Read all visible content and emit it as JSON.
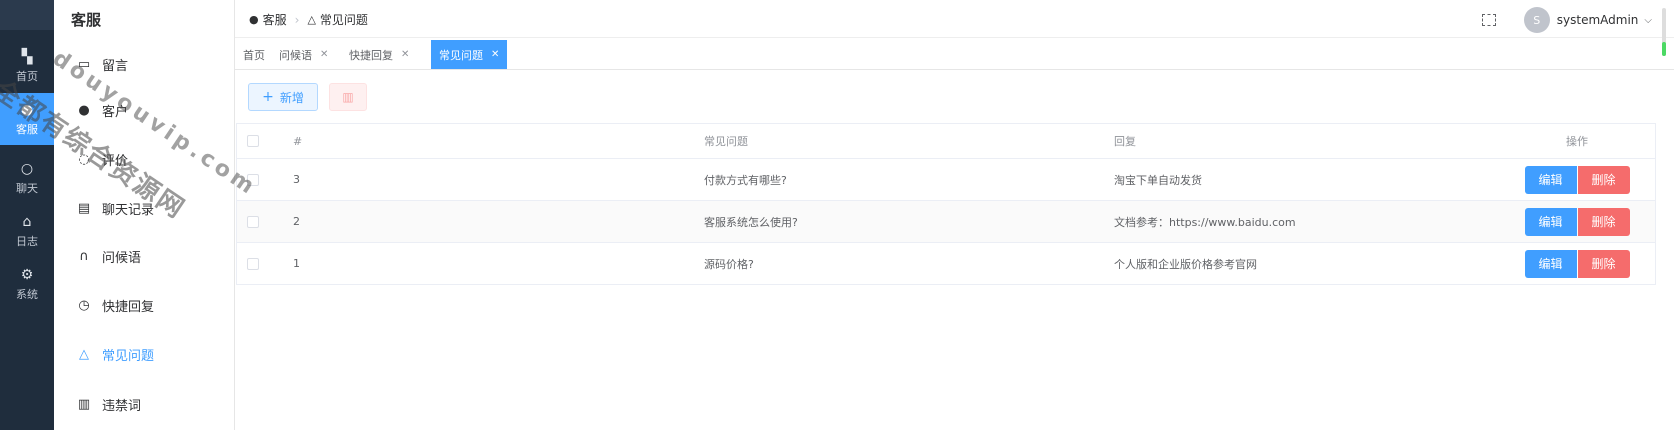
{
  "nav": {
    "items": [
      {
        "label": "首页",
        "icon": "dashboard-icon"
      },
      {
        "label": "客服",
        "icon": "user-icon",
        "active": true
      },
      {
        "label": "聊天",
        "icon": "person-icon"
      },
      {
        "label": "日志",
        "icon": "home-icon"
      },
      {
        "label": "系统",
        "icon": "gear-icon"
      }
    ]
  },
  "submenu": {
    "title": "客服",
    "items": [
      {
        "label": "留言",
        "icon": "message-box-icon"
      },
      {
        "label": "客户",
        "icon": "users-icon"
      },
      {
        "label": "评价",
        "icon": "comment-icon"
      },
      {
        "label": "聊天记录",
        "icon": "chat-record-icon"
      },
      {
        "label": "问候语",
        "icon": "headset-icon"
      },
      {
        "label": "快捷回复",
        "icon": "clock-icon"
      },
      {
        "label": "常见问题",
        "icon": "bell-icon",
        "active": true
      },
      {
        "label": "违禁词",
        "icon": "trash-icon"
      }
    ]
  },
  "header": {
    "breadcrumb": [
      "客服",
      "常见问题"
    ],
    "avatar_letter": "S",
    "username": "systemAdmin"
  },
  "tabs": [
    {
      "label": "首页",
      "closable": false
    },
    {
      "label": "问候语",
      "closable": true
    },
    {
      "label": "快捷回复",
      "closable": true
    },
    {
      "label": "常见问题",
      "closable": true,
      "active": true
    }
  ],
  "toolbar": {
    "add_label": "新增",
    "delete_icon": "trash-icon"
  },
  "table": {
    "columns": [
      "#",
      "常见问题",
      "回复",
      "操作"
    ],
    "rows": [
      {
        "id": "3",
        "question": "付款方式有哪些?",
        "answer": "淘宝下单自动发货"
      },
      {
        "id": "2",
        "question": "客服系统怎么使用?",
        "answer": "文档参考：https://www.baidu.com"
      },
      {
        "id": "1",
        "question": "源码价格?",
        "answer": "个人版和企业版价格参考官网"
      }
    ],
    "edit_label": "编辑",
    "delete_label": "删除"
  },
  "watermark": {
    "line1": "全都有综合资源网",
    "line2": "douyouvip.com"
  },
  "colors": {
    "primary": "#409eff",
    "danger": "#f56c6c",
    "sidebar": "#1f2d3d"
  }
}
